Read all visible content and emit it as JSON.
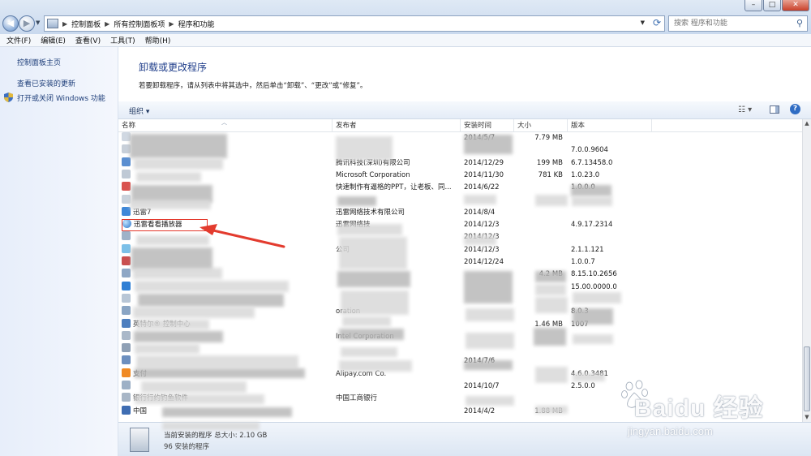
{
  "address": {
    "crumbs": [
      "控制面板",
      "所有控制面板项",
      "程序和功能"
    ],
    "search_placeholder": "搜索 程序和功能"
  },
  "menu": [
    "文件(F)",
    "编辑(E)",
    "查看(V)",
    "工具(T)",
    "帮助(H)"
  ],
  "left_panel": {
    "links": [
      "控制面板主页",
      "查看已安装的更新",
      "打开或关闭 Windows 功能"
    ]
  },
  "page": {
    "title": "卸载或更改程序",
    "description": "若要卸载程序，请从列表中将其选中，然后单击“卸载”、“更改”或“修复”。"
  },
  "toolbar": {
    "organize": "组织 ▾"
  },
  "columns": [
    "名称",
    "发布者",
    "安装时间",
    "大小",
    "版本"
  ],
  "rows": [
    {
      "name": "",
      "publisher": "",
      "date": "2014/5/7",
      "size": "7.79 MB",
      "version": ""
    },
    {
      "name": "",
      "publisher": "",
      "date": "",
      "size": "",
      "version": "7.0.0.9604"
    },
    {
      "name": "",
      "publisher": "腾讯科技(深圳)有限公司",
      "date": "2014/12/29",
      "size": "199 MB",
      "version": "6.7.13458.0"
    },
    {
      "name": "",
      "publisher": "Microsoft Corporation",
      "date": "2014/11/30",
      "size": "781 KB",
      "version": "1.0.23.0"
    },
    {
      "name": "",
      "publisher": "快速制作有逼格的PPT，让老板、同...",
      "date": "2014/6/22",
      "size": "",
      "version": "1.0.0.0"
    },
    {
      "name": "",
      "publisher": "",
      "date": "",
      "size": "",
      "version": ""
    },
    {
      "name": "迅雷7",
      "publisher": "迅雷网络技术有限公司",
      "date": "2014/8/4",
      "size": "",
      "version": ""
    },
    {
      "name": "迅雷看看播放器",
      "publisher": "迅雷网络技",
      "date": "2014/12/3",
      "size": "",
      "version": "4.9.17.2314"
    },
    {
      "name": "",
      "publisher": "",
      "date": "2014/12/3",
      "size": "",
      "version": ""
    },
    {
      "name": "",
      "publisher": "公司",
      "date": "2014/12/3",
      "size": "",
      "version": "2.1.1.121"
    },
    {
      "name": "",
      "publisher": "",
      "date": "2014/12/24",
      "size": "",
      "version": "1.0.0.7"
    },
    {
      "name": "",
      "publisher": "",
      "date": "",
      "size": "4.2 MB",
      "version": "8.15.10.2656"
    },
    {
      "name": "",
      "publisher": "",
      "date": "",
      "size": "",
      "version": "15.00.0000.0"
    },
    {
      "name": "",
      "publisher": "",
      "date": "",
      "size": "",
      "version": ""
    },
    {
      "name": "",
      "publisher": "oration",
      "date": "",
      "size": "",
      "version": "8.0.3"
    },
    {
      "name": "英特尔® 控制中心",
      "publisher": "",
      "date": "",
      "size": "1.46 MB",
      "version": "1007"
    },
    {
      "name": "",
      "publisher": "Intel Corporation",
      "date": "",
      "size": "",
      "version": ""
    },
    {
      "name": "",
      "publisher": "",
      "date": "",
      "size": "",
      "version": ""
    },
    {
      "name": "",
      "publisher": "",
      "date": "2014/7/6",
      "size": "",
      "version": ""
    },
    {
      "name": "支付",
      "publisher": "Alipay.com Co.",
      "date": "",
      "size": "",
      "version": "4.6.0.3481"
    },
    {
      "name": "",
      "publisher": "",
      "date": "2014/10/7",
      "size": "",
      "version": "2.5.0.0"
    },
    {
      "name": "银行行约钓鱼软件",
      "publisher": "中国工商银行",
      "date": "",
      "size": "",
      "version": ""
    },
    {
      "name": "中国",
      "publisher": "",
      "date": "2014/4/2",
      "size": "1.88 MB",
      "version": ""
    }
  ],
  "status": {
    "line1": "当前安装的程序 总大小: 2.10 GB",
    "line2": "96 安装的程序"
  },
  "watermark": {
    "logo": "Baidu 经验",
    "url": "jingyan.baidu.com"
  }
}
